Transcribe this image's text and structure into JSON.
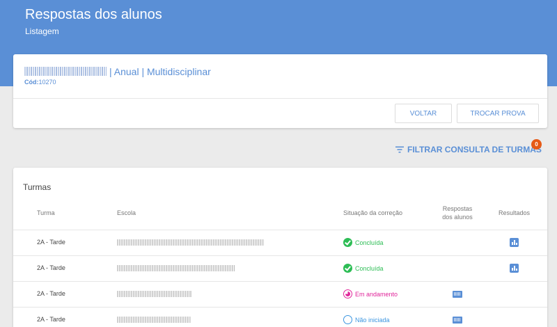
{
  "header": {
    "title": "Respostas dos alunos",
    "subtitle": "Listagem"
  },
  "exam": {
    "name_suffix": "| Anual | Multidisciplinar",
    "code_label": "Cód:",
    "code_value": "10270"
  },
  "buttons": {
    "back": "VOLTAR",
    "change_exam": "TROCAR PROVA"
  },
  "filter": {
    "label": "FILTRAR CONSULTA DE TURMAS",
    "badge": "0",
    "icon": "filter-list-icon"
  },
  "table": {
    "title": "Turmas",
    "headers": {
      "turma": "Turma",
      "escola": "Escola",
      "situacao": "Situação da correção",
      "respostas_1": "Respostas",
      "respostas_2": "dos alunos",
      "resultados": "Resultados"
    },
    "rows": [
      {
        "turma": "2A - Tarde",
        "status": "Concluída",
        "status_type": "done",
        "status_color": "#2dbd55",
        "has_answers": false,
        "has_results": true
      },
      {
        "turma": "2A - Tarde",
        "status": "Concluída",
        "status_type": "done",
        "status_color": "#2dbd55",
        "has_answers": false,
        "has_results": true
      },
      {
        "turma": "2A - Tarde",
        "status": "Em andamento",
        "status_type": "progress",
        "status_color": "#e0259a",
        "has_answers": true,
        "has_results": false
      },
      {
        "turma": "2A - Tarde",
        "status": "Não iniciada",
        "status_type": "notstarted",
        "status_color": "#3a95e0",
        "has_answers": true,
        "has_results": false
      }
    ]
  },
  "colors": {
    "accent": "#5a8fd6",
    "badge": "#e65a16"
  }
}
